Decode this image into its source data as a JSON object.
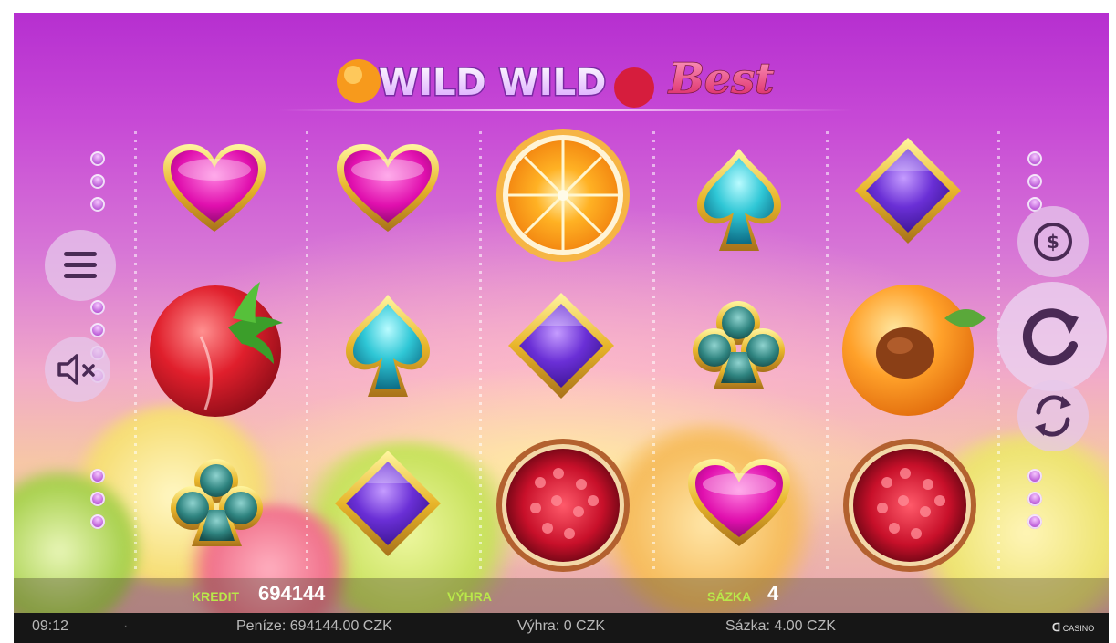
{
  "logo": {
    "part1": "WILD WILD",
    "part2": "Best"
  },
  "reels": [
    [
      "heart",
      "strawberry",
      "club"
    ],
    [
      "heart",
      "spade",
      "diamond"
    ],
    [
      "orange",
      "diamond",
      "pomegranate"
    ],
    [
      "spade",
      "club",
      "heart"
    ],
    [
      "diamond",
      "apricot",
      "pomegranate"
    ]
  ],
  "side_controls": {
    "left": [
      "menu-icon",
      "sound-muted-icon"
    ],
    "right": [
      "coin-icon",
      "spin-icon",
      "autoplay-icon"
    ]
  },
  "infobar": {
    "credit_label": "KREDIT",
    "credit_value": "694144",
    "win_label": "VÝHRA",
    "bet_label": "SÁZKA",
    "bet_value": "4"
  },
  "statusbar": {
    "time": "09:12",
    "sep": "·",
    "money": "Peníze: 694144.00 CZK",
    "win": "Výhra: 0 CZK",
    "bet": "Sázka: 4.00 CZK",
    "brand": "CASINO"
  },
  "colors": {
    "label_green": "#b9e84a",
    "bg_purple": "#c749d6"
  }
}
